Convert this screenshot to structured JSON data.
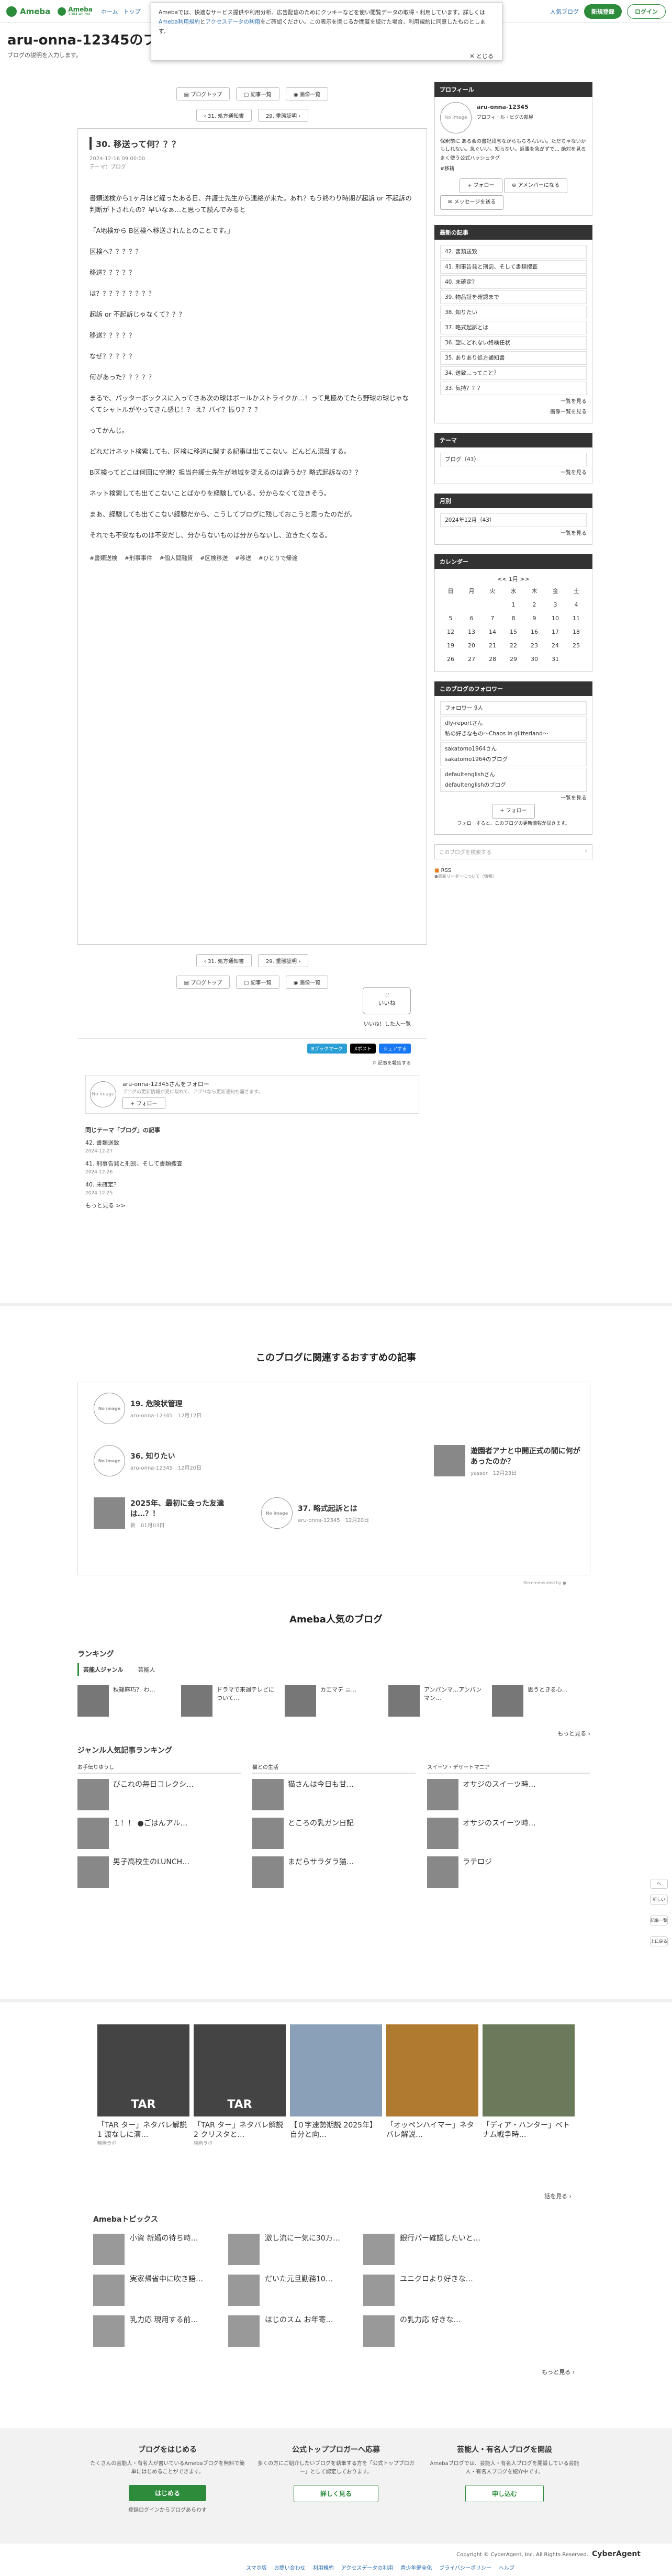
{
  "topbar": {
    "brand": "Ameba",
    "brand2": "Ameba",
    "brand2_sub": "2004 Anima",
    "nav": [
      "ホーム",
      "トップ"
    ],
    "right_link": "人気ブログ",
    "signup": "新規登録",
    "login": "ログイン"
  },
  "cookie": {
    "text1": "Amebaでは、快適なサービス提供や利用分析、広告配信のためにクッキーなどを使い閲覧データの取得・利用しています。詳しくは",
    "link1": "Ameba利用規約",
    "mid": "と",
    "link2": "アクセスデータの利用",
    "text2": "をご確認ください。この表示を閉じるか閲覧を続けた場合、利用規約に同意したものとします。",
    "close": "とじる"
  },
  "header": {
    "title": "aru-onna-12345のブログ",
    "desc": "ブログの説明を入力します。"
  },
  "nav_pills": {
    "top": "ブログトップ",
    "list": "記事一覧",
    "gallery": "画像一覧"
  },
  "pager": {
    "prev": "31. 処方通知書",
    "next": "29. 重態証明"
  },
  "article": {
    "title": "30. 移送って何？？？",
    "date": "2024-12-16 09:00:00",
    "theme": "テーマ：ブログ",
    "paras": [
      "書類送検から1ヶ月ほど経ったある日、弁護士先生から連絡が来た。あれ？もう終わり時期が起訴 or 不起訴の判断が下されたの？早いなぁ…と思って読んでみると",
      "「A地検から B区検へ移送されたとのことです。」",
      "区検へ？？？？？",
      "移送？？？？？",
      "は？？？？？？？？？",
      "起訴 or 不起訴じゃなくて？？？",
      "移送？？？？？",
      "なぜ？？？？？",
      "何があった？？？？？",
      "まるで、パッターボックスに入ってさあ次の球はボールかストライクか…！って見極めてたら野球の球じゃなくてシャトルがやってきた感じ！？ え？バイ？振り？？？",
      "ってかんじ。",
      "どれだけネット検索しても、区検に移送に関する記事は出てこない。どんどん混乱する。",
      "B区検ってどこは何回に空港？担当弁護士先生が地域を変えるのは違うか？略式起訴なの？？",
      "ネット検索しても出てこないことばかりを経験している。分からなくて泣きそう。",
      "まあ、経験しても出てこない経験だから、こうしてブログに残しておこうと思ったのだが。",
      "それでも不安なものは不安だし、分からないものは分からないし、泣きたくなる。"
    ],
    "tags": [
      "#書類送検",
      "#刑事事件",
      "#個人間融資",
      "#区検移送",
      "#移送",
      "#ひとりで帰途"
    ],
    "like": "いいね",
    "like_list": "いいね！した人一覧",
    "share": [
      "Bブックマーク",
      "Xポスト",
      "シェアする"
    ],
    "report": "記事を報告する",
    "follow_name": "aru-onna-12345さんをフォロー",
    "follow_sub": "ブログの更新情報が受け取れて、アプリなら更新通知も届きます。",
    "follow_btn": "フォロー",
    "same_theme_h": "同じテーマ「ブログ」の記事",
    "same_theme": [
      {
        "t": "42. 書類送致",
        "d": "2024-12-27"
      },
      {
        "t": "41. 刑事告発と刑罰、そして書類捜査",
        "d": "2024-12-26"
      },
      {
        "t": "40. 未確定？",
        "d": "2024-12-25"
      }
    ],
    "more": "もっと見る >>"
  },
  "side": {
    "profile_h": "プロフィール",
    "name": "aru-onna-12345",
    "sub": "プロフィール・ピグの部屋",
    "avatar_label": "No image",
    "bio": "保釈前に ある会の書記残念ながらもちろんいい。ただちゃないかもしれない。急ぐいい。知らない。返事を急がずで… 絶対を見る",
    "links": [
      "まく使う公式ハッシュタグ",
      "#移籍"
    ],
    "follow": "フォロー",
    "amember": "アメンバーになる",
    "message": "メッセージを送る",
    "recent_h": "最新の記事",
    "recent": [
      "42. 書類送致",
      "41. 刑事告発と刑罰、そして書類捜査",
      "40. 未確定？",
      "39. 物品証を確認まで",
      "38. 知りたい",
      "37. 略式起訴とは",
      "36. 望にどれない終検任状",
      "35. ありあり処方通知書",
      "34. 送致…ってこと？",
      "33. 気持？？？"
    ],
    "recent_more": "一覧を見る",
    "gallery": "画像一覧を見る",
    "theme_h": "テーマ",
    "theme": "ブログ（43）",
    "theme_more": "一覧を見る",
    "month_h": "月別",
    "month": "2024年12月（43）",
    "month_more": "一覧を見る",
    "cal_h": "カレンダー",
    "cal_title": "1月",
    "cal_days": [
      "日",
      "月",
      "火",
      "水",
      "木",
      "金",
      "土"
    ],
    "cal_rows": [
      [
        "",
        "",
        "",
        "1",
        "2",
        "3",
        "4"
      ],
      [
        "5",
        "6",
        "7",
        "8",
        "9",
        "10",
        "11"
      ],
      [
        "12",
        "13",
        "14",
        "15",
        "16",
        "17",
        "18"
      ],
      [
        "19",
        "20",
        "21",
        "22",
        "23",
        "24",
        "25"
      ],
      [
        "26",
        "27",
        "28",
        "29",
        "30",
        "31",
        ""
      ]
    ],
    "followers_h": "このブログのフォロワー",
    "followers_count": "フォロワー 9人",
    "followers": [
      "dly-reportさん",
      "私の好きなもの〜Chaos in glitterland〜",
      "sakatomo1964さん",
      "sakatomo1964のブログ",
      "defaultenglishさん",
      "defaultenglishのブログ"
    ],
    "followers_more": "一覧を見る",
    "follow2": "フォロー",
    "follow_note": "フォローすると、このブログの更新情報が届きます。",
    "search_placeholder": "このブログを検索する",
    "rss": "RSS",
    "rss_sub": "●最新リーダーについて（情報）"
  },
  "recommend": {
    "title": "このブログに関連するおすすめの記事",
    "items": [
      {
        "t": "19. 危険状管理",
        "sub": "aru-onna-12345　12月12日"
      },
      {
        "t": "36. 知りたい",
        "sub": "aru-onna-12345　12月20日"
      },
      {
        "t": "遊園者アナと中開正式の間に何があったのか？",
        "sub": "yasser　12月23日"
      },
      {
        "t": "2025年、最初に会った友達は…？！",
        "sub": "新　01月03日"
      },
      {
        "t": "37. 略式起訴とは",
        "sub": "aru-onna-12345　12月20日"
      }
    ],
    "powered": "Recommended by"
  },
  "popular": {
    "title": "Ameba人気のブログ",
    "ranking_h": "ランキング",
    "tabs": [
      "芸能人ジャンル",
      "芸能人"
    ],
    "ranking": [
      "秋篠麻巧？ わ…",
      "ドラマで来週テレビについて…",
      "カエマデ ニ…",
      "アンパンマ…アンパンマン…",
      "思うときる心…"
    ],
    "more": "もっと見る",
    "genre_h": "ジャンル人気記事ランキング",
    "cols": [
      {
        "h": "お手伝りゆうし",
        "rows": [
          "びこれの毎日コレクシ…",
          "１！！ ●ごはんアル…",
          "男子高校生のLUNCH…"
        ]
      },
      {
        "h": "猫との生活",
        "rows": [
          "猫さんは今日も甘…",
          "ところの乳ガン日記",
          "まだらサラダラ猫…"
        ]
      },
      {
        "h": "スイーツ・デザートマニア",
        "rows": [
          "オサジのスイーツ時…",
          "オサジのスイーツ時…",
          "ラテロジ"
        ]
      }
    ]
  },
  "videos": [
    {
      "t": "「TAR ター」ネタバレ解説1 渡なしに演…",
      "sub": "映画ラボ"
    },
    {
      "t": "「TAR ター」ネタバレ解説2 クリスタと…",
      "sub": "映画ラボ"
    },
    {
      "t": "【０字速勢期説 2025年】自分と向…",
      "sub": ""
    },
    {
      "t": "「オッペンハイマー」ネタバレ解説…",
      "sub": ""
    },
    {
      "t": "「ディア・ハンター」ベトナム戦争時…",
      "sub": ""
    }
  ],
  "videos_more": "話を見る",
  "topics": {
    "h": "Amebaトピックス",
    "items": [
      "小資 新婚の待ち時…",
      "激し流に一気に30万…",
      "銀行パー確認したいと…",
      "実家帰省中に吹き語…",
      "だいた元旦勤務10…",
      "ユニクロより好きな…",
      "乳力応 現用する前…",
      "はじのスム お年寄…",
      "の乳力応 好きな…"
    ],
    "more": "もっと見る"
  },
  "bottom": [
    {
      "h": "ブログをはじめる",
      "p": "たくさんの芸能人・有名人が書いているAmebaブログを無料で簡単にはじめることができます。",
      "b": "はじめる",
      "note": "登録ログインからブログあらわす"
    },
    {
      "h": "公式トップブロガーへ応募",
      "p": "多くの方にご紹介したいブログを執筆する方を「公式トップブロガー」として認定しております。",
      "b": "詳しく見る"
    },
    {
      "h": "芸能人・有名人ブログを開設",
      "p": "Amebaブログでは、芸能人・有名人ブログを開設している芸能人・有名人ブログを紹介中です。",
      "b": "申し込む"
    }
  ],
  "footer": {
    "copyright": "Copyright © CyberAgent, Inc. All Rights Reserved.",
    "brand": "CyberAgent",
    "links": [
      "ヘルプ",
      "利用規約",
      "アクセスデータの利用",
      "青少年健全化",
      "プライバシーポリシー",
      "お問い合わせ",
      "スマホ版"
    ]
  },
  "fixed": [
    "ヘ",
    "新しい",
    "記事一覧",
    "上に戻る"
  ]
}
